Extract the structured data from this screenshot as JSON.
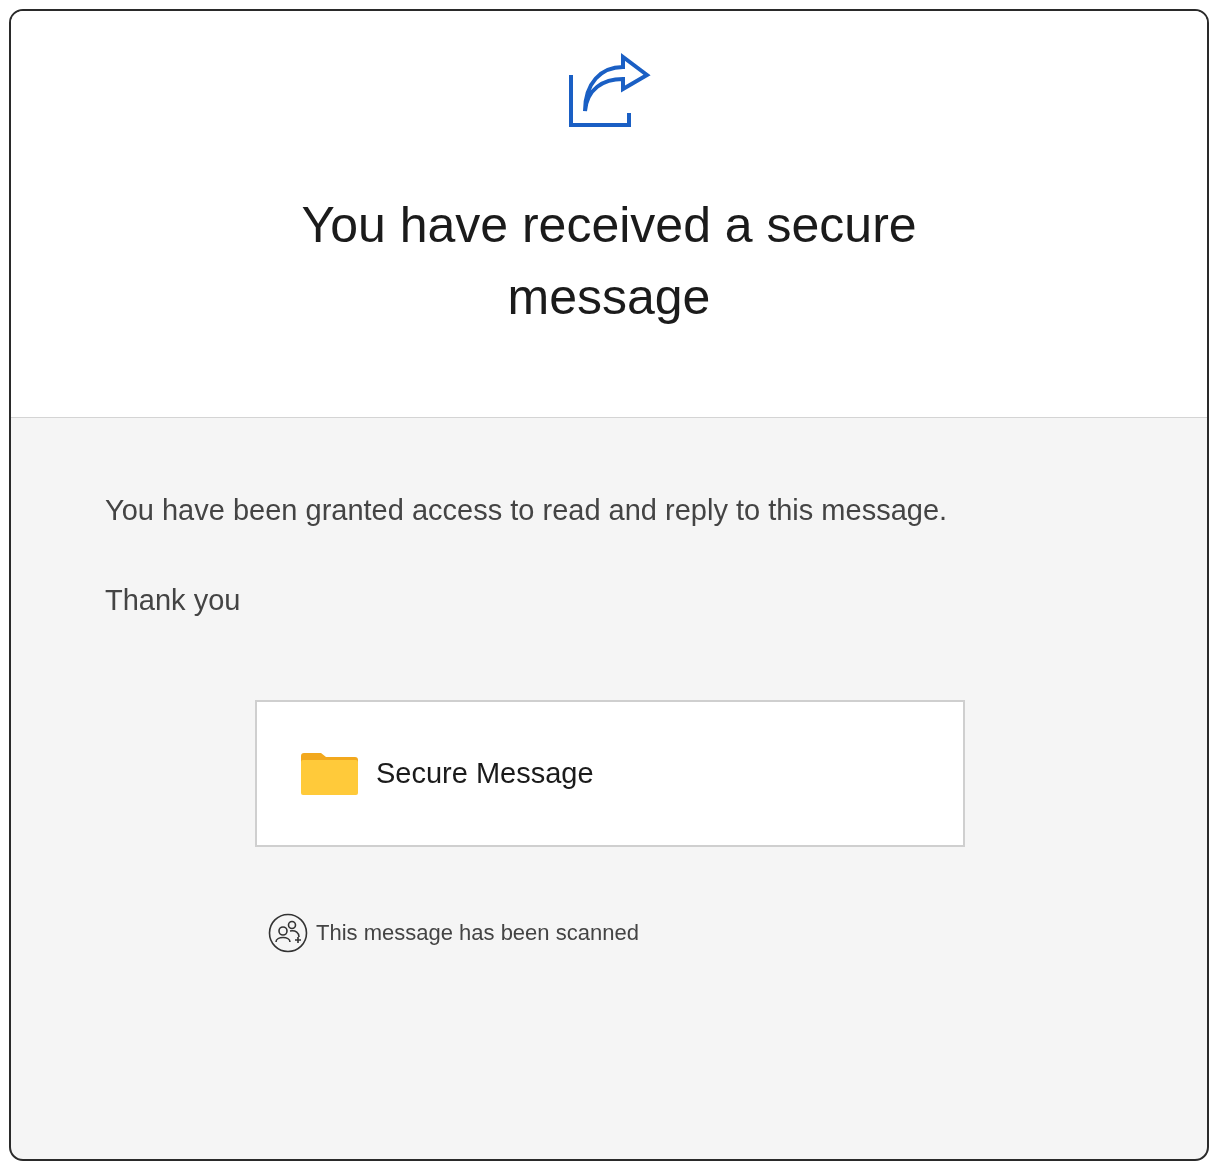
{
  "header": {
    "title": "You have received a secure message"
  },
  "body": {
    "paragraphs": [
      "You have been granted access to read and reply to this message.",
      "Thank you"
    ]
  },
  "attachment": {
    "label": "Secure Message"
  },
  "scan_notice": {
    "text": "This message has been scanned"
  }
}
